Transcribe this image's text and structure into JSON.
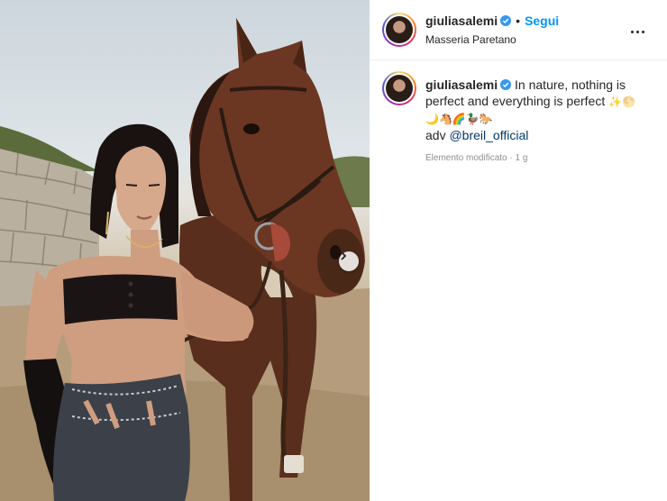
{
  "post": {
    "username": "giuliasalemi",
    "dot": "•",
    "follow_label": "Segui",
    "location": "Masseria Paretano",
    "more_label": "More options"
  },
  "caption": {
    "username": "giuliasalemi",
    "text": "In nature, nothing is perfect and everything is perfect",
    "emoji_line1": "✨🌕",
    "emoji_line2": "🌙🐴🌈🦆🐎",
    "adv_label": "adv",
    "mention": "@breil_official"
  },
  "meta": {
    "edited": "Elemento modificato",
    "separator": " · ",
    "age": "1 g"
  },
  "colors": {
    "link": "#0095f6",
    "mention": "#00376b",
    "meta": "#8e8e8e",
    "verified": "#3897f0"
  },
  "icons": {
    "verified": "verified-badge-icon",
    "more": "more-options-icon",
    "next": "chevron-right-icon"
  }
}
